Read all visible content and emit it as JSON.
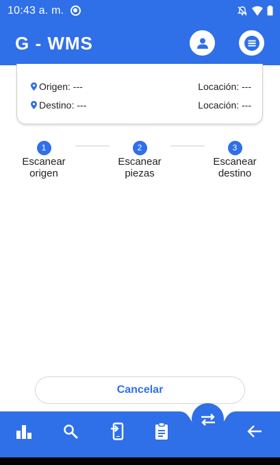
{
  "status_bar": {
    "time": "10:43 a. m."
  },
  "app_bar": {
    "title": "G - WMS",
    "profile_icon": "account-icon",
    "menu_icon": "menu-icon"
  },
  "route_card": {
    "origin_label": "Origen: ---",
    "origin_location": "Locación: ---",
    "destination_label": "Destino: ---",
    "destination_location": "Locación: ---"
  },
  "steps": [
    {
      "number": "1",
      "line1": "Escanear",
      "line2": "origen"
    },
    {
      "number": "2",
      "line1": "Escanear",
      "line2": "piezas"
    },
    {
      "number": "3",
      "line1": "Escanear",
      "line2": "destino"
    }
  ],
  "cancel_label": "Cancelar",
  "bottom_nav": {
    "items": [
      "bar-chart-icon",
      "search-icon",
      "transfer-in-icon",
      "clipboard-icon",
      "swap-icon",
      "back-arrow-icon"
    ]
  },
  "colors": {
    "primary": "#2f6fe8",
    "card_border": "#cfcfcf",
    "text": "#222222"
  }
}
